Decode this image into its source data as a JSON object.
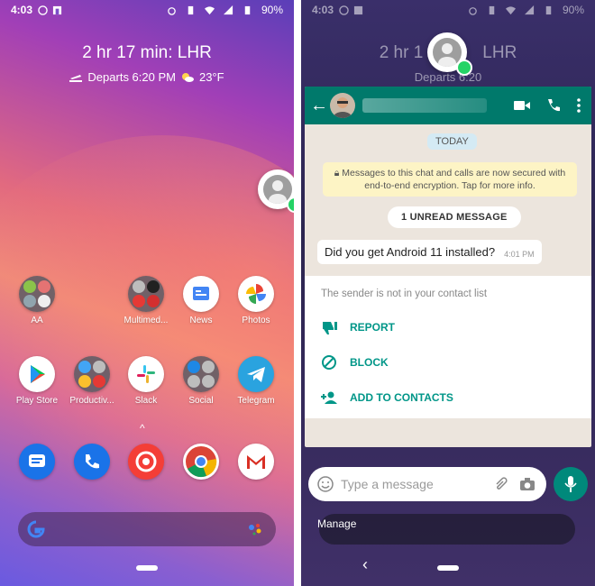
{
  "left": {
    "status": {
      "time": "4:03",
      "battery": "90%"
    },
    "glance": {
      "title": "2 hr 17 min: LHR",
      "departs": "Departs 6:20 PM",
      "weather": "23°F"
    },
    "apps_row1": [
      "AA",
      "",
      "Multimed...",
      "News",
      "Photos"
    ],
    "apps_row2": [
      "Play Store",
      "Productiv...",
      "Slack",
      "Social",
      "Telegram"
    ],
    "dock_caret": "^"
  },
  "right": {
    "status": {
      "time": "4:03",
      "battery": "90%"
    },
    "glance": {
      "title": "2 hr 1",
      "title_tail": "LHR",
      "departs": "Departs 6:20"
    },
    "chat": {
      "date_pill": "TODAY",
      "encryption": "Messages to this chat and calls are now secured with end-to-end encryption. Tap for more info.",
      "unread": "1 UNREAD MESSAGE",
      "message": "Did you get Android 11 installed?",
      "message_time": "4:01 PM",
      "sender_note": "The sender is not in your contact list",
      "options": [
        "REPORT",
        "BLOCK",
        "ADD TO CONTACTS"
      ],
      "compose_placeholder": "Type a message"
    },
    "manage": "Manage",
    "nav_back": "‹"
  },
  "colors": {
    "whatsapp_teal": "#00796b",
    "whatsapp_green": "#25d366",
    "accent_teal": "#009688"
  }
}
